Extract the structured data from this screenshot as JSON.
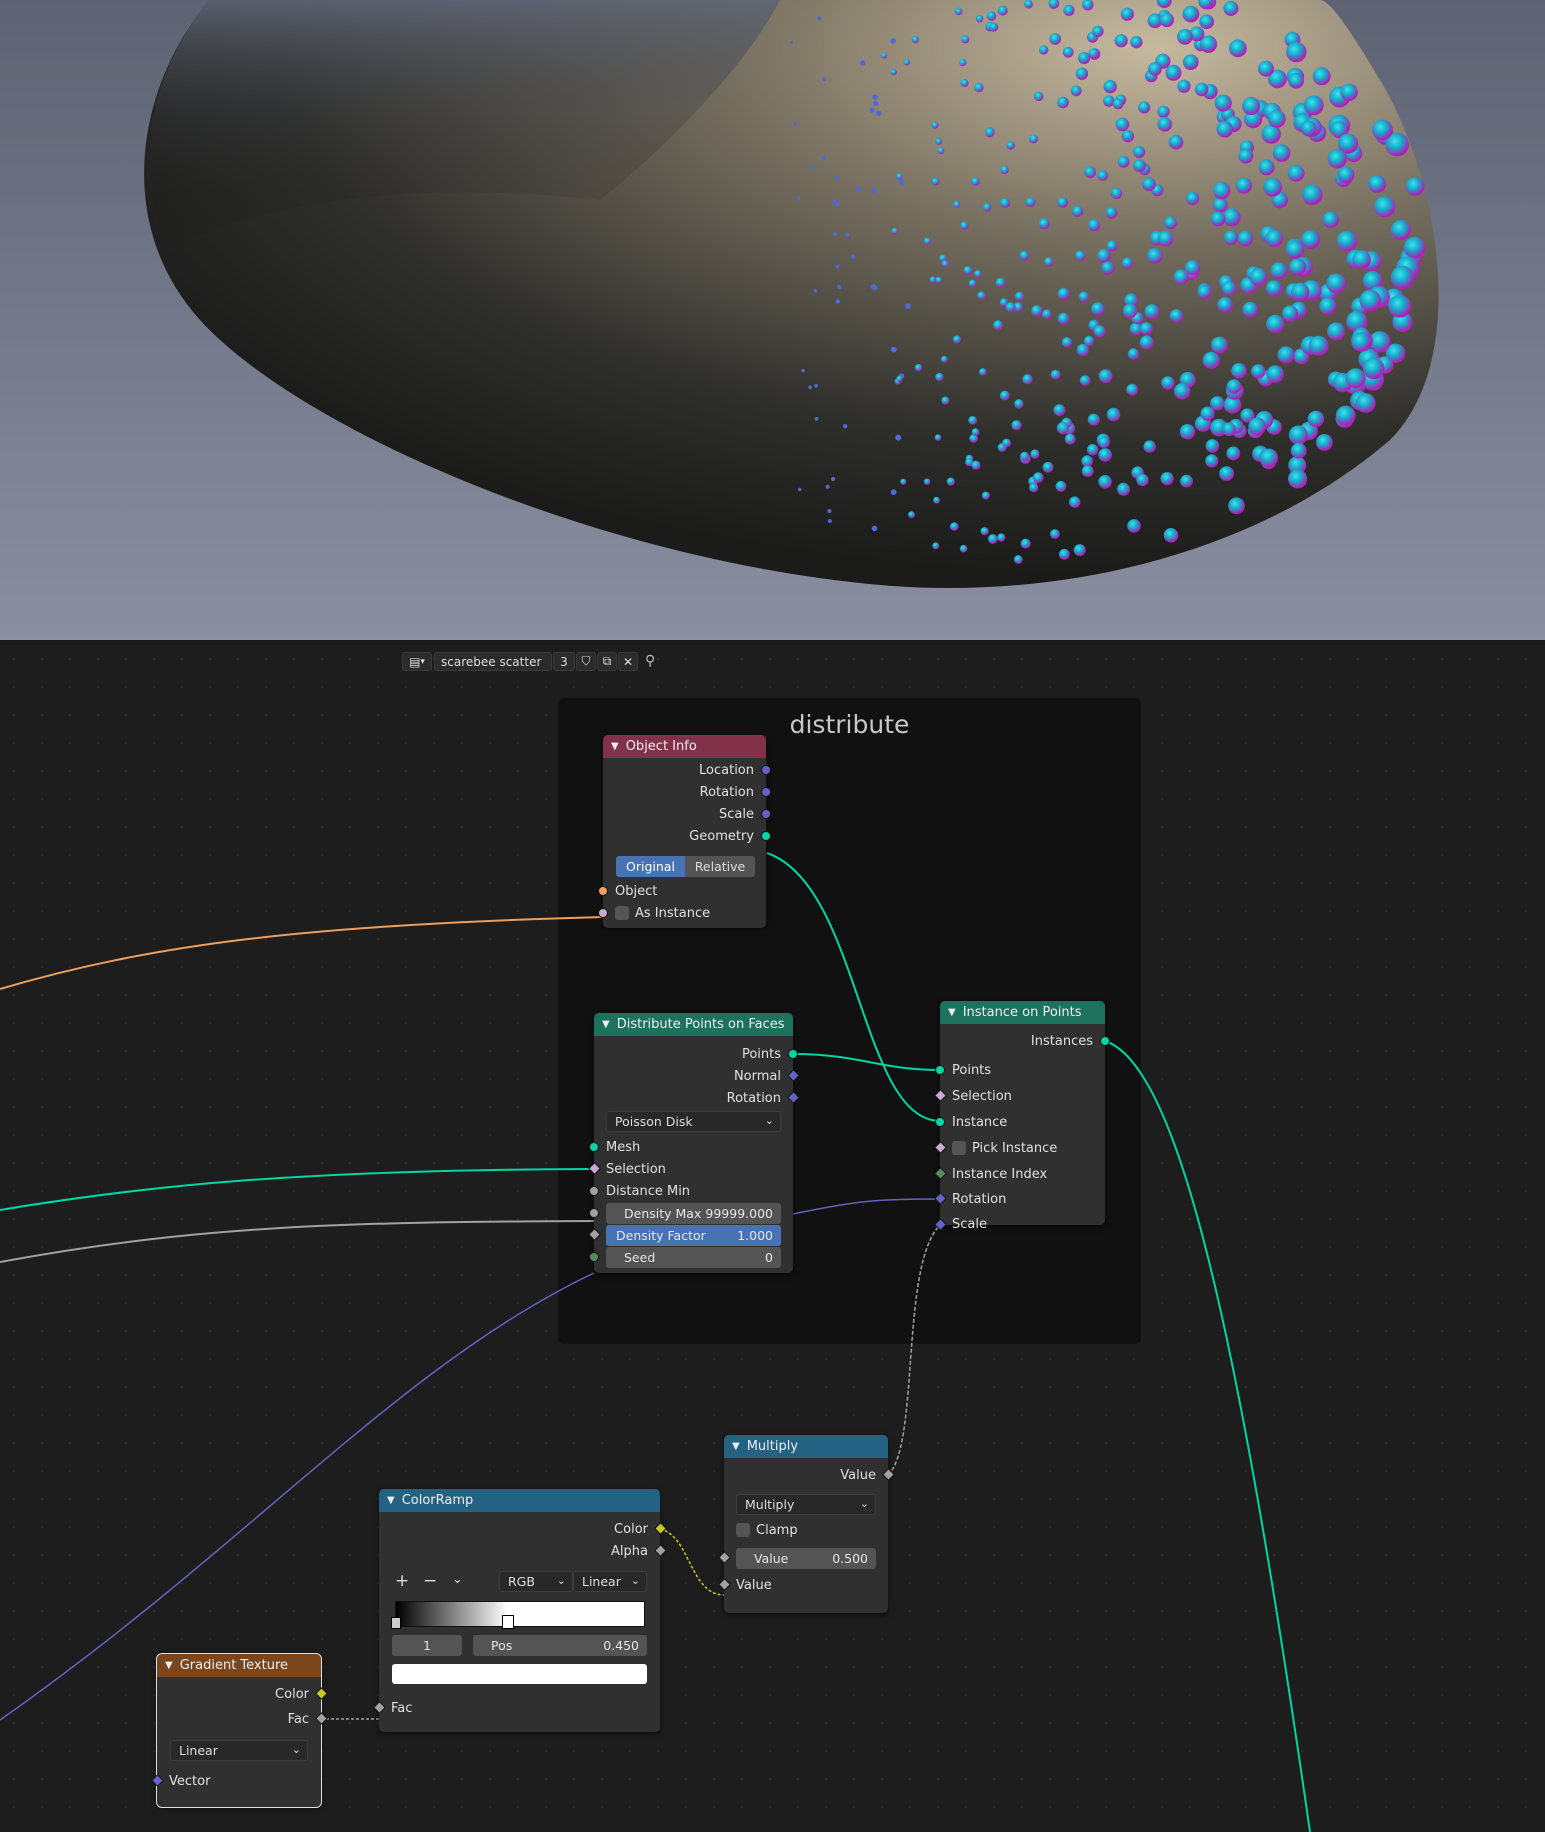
{
  "editor": {
    "node_tree_name": "scarebee scatter",
    "user_count": "3"
  },
  "frame": {
    "label": "distribute"
  },
  "nodes": {
    "object_info": {
      "title": "Object Info",
      "outputs": [
        "Location",
        "Rotation",
        "Scale",
        "Geometry"
      ],
      "transform_space": {
        "options": [
          "Original",
          "Relative"
        ],
        "selected": "Original"
      },
      "inputs": {
        "object": "Object",
        "as_instance": "As Instance"
      }
    },
    "distribute_points": {
      "title": "Distribute Points on Faces",
      "outputs": [
        "Points",
        "Normal",
        "Rotation"
      ],
      "mode": "Poisson Disk",
      "inputs": {
        "mesh": "Mesh",
        "selection": "Selection",
        "distance_min": "Distance Min"
      },
      "density_max": {
        "label": "Density Max",
        "value": "99999.000"
      },
      "density_factor": {
        "label": "Density Factor",
        "value": "1.000"
      },
      "seed": {
        "label": "Seed",
        "value": "0"
      }
    },
    "instance_on_points": {
      "title": "Instance on Points",
      "output": "Instances",
      "inputs": [
        "Points",
        "Selection",
        "Instance",
        "Pick Instance",
        "Instance Index",
        "Rotation",
        "Scale"
      ]
    },
    "multiply": {
      "title": "Multiply",
      "output": "Value",
      "operation": "Multiply",
      "clamp": "Clamp",
      "value_field": {
        "label": "Value",
        "value": "0.500"
      },
      "input_value": "Value"
    },
    "color_ramp": {
      "title": "ColorRamp",
      "outputs": [
        "Color",
        "Alpha"
      ],
      "color_mode": "RGB",
      "interpolation": "Linear",
      "active_stop": "1",
      "pos": {
        "label": "Pos",
        "value": "0.450"
      },
      "input": "Fac",
      "stop_positions": [
        0.0,
        0.45
      ]
    },
    "gradient_texture": {
      "title": "Gradient Texture",
      "outputs": [
        "Color",
        "Fac"
      ],
      "type": "Linear",
      "input": "Vector"
    }
  },
  "colors": {
    "geometry_socket": "#00d6a3",
    "vector_socket": "#6363c7",
    "float_socket": "#a1a1a1",
    "object_socket": "#ed9e5c",
    "bool_socket": "#cca6d6",
    "int_socket": "#598c5c",
    "color_socket": "#c7c729",
    "header_input": "#83314a",
    "header_geometry": "#1d725e",
    "header_converter": "#246283",
    "header_texture": "#79461d"
  }
}
